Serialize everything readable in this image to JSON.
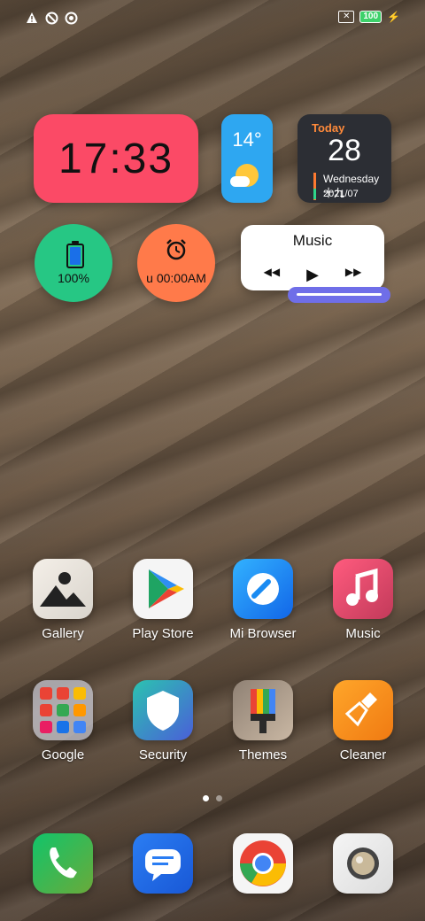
{
  "status_bar": {
    "left_icons": [
      "warning-icon",
      "no-disturb-icon",
      "sync-off-icon"
    ],
    "sim_label": "✕",
    "battery_level": "100",
    "charging_icon": "bolt-icon"
  },
  "widgets": {
    "clock": {
      "time": "17:33"
    },
    "weather": {
      "temperature": "14°"
    },
    "calendar": {
      "today_label": "Today",
      "day": "28",
      "weekday": "Wednesday 十九",
      "year_month": "2021/07"
    },
    "battery": {
      "percent": "100%"
    },
    "alarm": {
      "text": "u 00:00AM"
    },
    "music": {
      "title": "Music",
      "prev": "◀◀",
      "play": "▶",
      "next": "▶▶"
    }
  },
  "apps_row1": [
    {
      "label": "Gallery"
    },
    {
      "label": "Play Store"
    },
    {
      "label": "Mi Browser"
    },
    {
      "label": "Music"
    }
  ],
  "apps_row2": [
    {
      "label": "Google"
    },
    {
      "label": "Security"
    },
    {
      "label": "Themes"
    },
    {
      "label": "Cleaner"
    }
  ],
  "dock": [
    "Phone",
    "Messages",
    "Chrome",
    "Camera"
  ],
  "colors": {
    "clock_bg": "#fb4a66",
    "weather_bg": "#2ea7f1",
    "calendar_bg": "#2c2e34",
    "battery_bg": "#26c784",
    "alarm_bg": "#ff7a4a",
    "music_bg": "#ffffff",
    "slider_bg": "#6f6ee8"
  },
  "page_indicator": {
    "pages": 2,
    "current": 1
  }
}
